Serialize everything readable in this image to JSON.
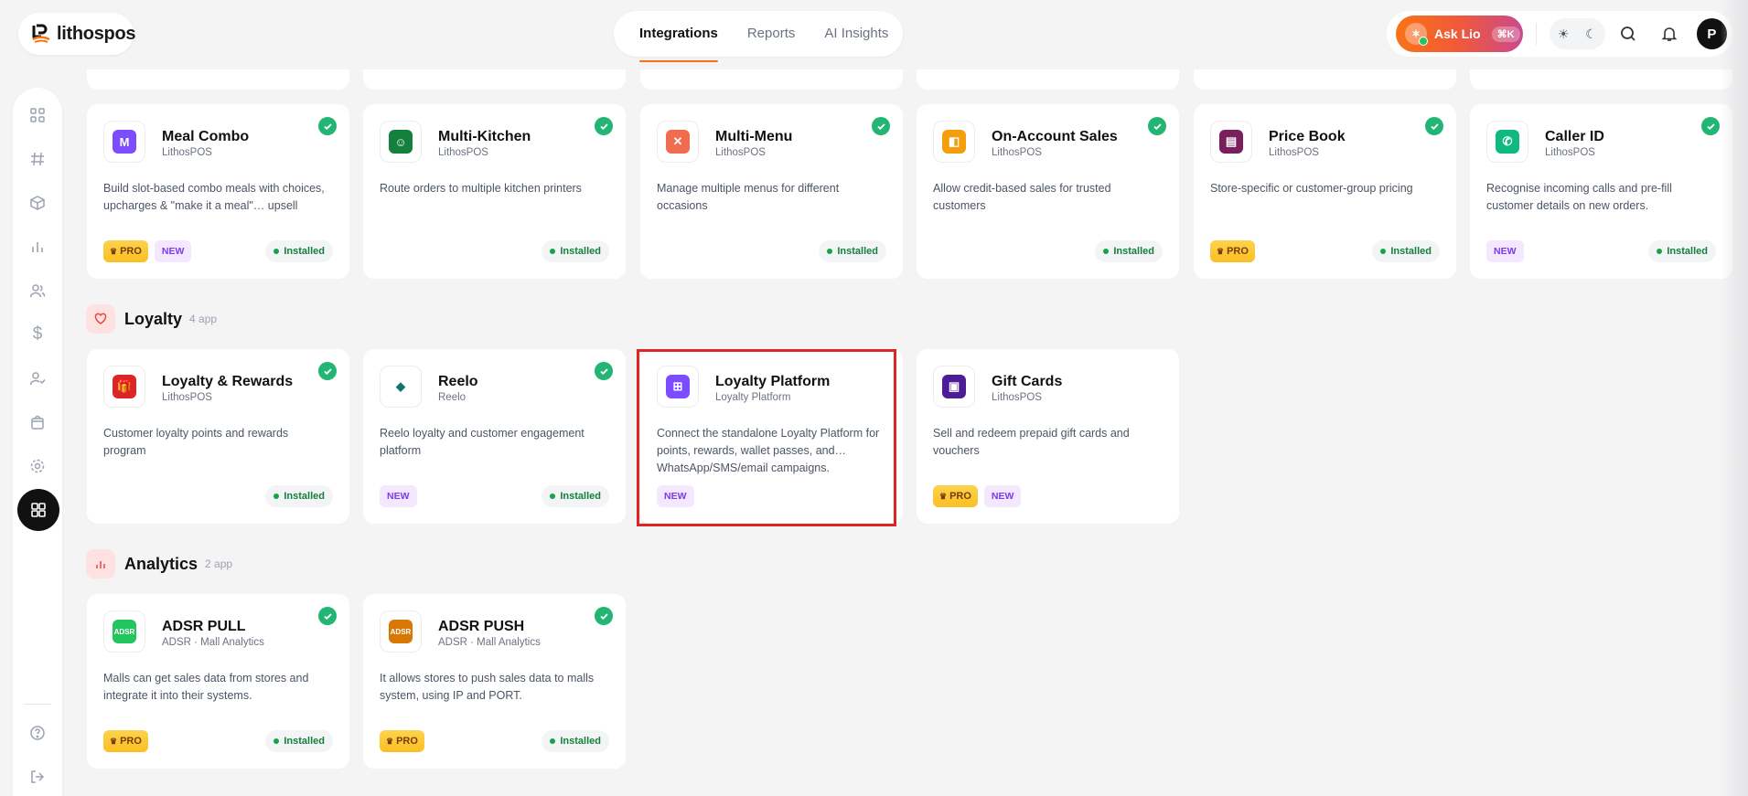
{
  "header": {
    "brand": "lithospos",
    "tabs": [
      {
        "label": "Integrations",
        "active": true
      },
      {
        "label": "Reports",
        "active": false
      },
      {
        "label": "AI Insights",
        "active": false
      }
    ],
    "ask_lio": {
      "label": "Ask Lio",
      "shortcut": "⌘K"
    },
    "avatar_initial": "P"
  },
  "sidebar": {
    "items": [
      "grid-icon",
      "hash-icon",
      "box-icon",
      "bar-chart-icon",
      "users-icon",
      "dollar-icon",
      "user-check-icon",
      "bag-icon",
      "settings-icon",
      "apps-icon"
    ],
    "active": "apps-icon",
    "footer": [
      "help-icon",
      "logout-icon"
    ]
  },
  "badges": {
    "pro": "PRO",
    "new": "NEW",
    "installed": "Installed"
  },
  "sections": {
    "top_row": [
      {
        "title": "Meal Combo",
        "vendor": "LithosPOS",
        "desc": "Build slot-based combo meals with choices, upcharges & \"make it a meal\"… upsell",
        "pro": true,
        "new": true,
        "installed": true,
        "icon": "combo-icon",
        "color": "#7c4dff",
        "glyph": "M"
      },
      {
        "title": "Multi-Kitchen",
        "vendor": "LithosPOS",
        "desc": "Route orders to multiple kitchen printers",
        "pro": false,
        "new": false,
        "installed": true,
        "icon": "chef-icon",
        "color": "#15803d",
        "glyph": "☺"
      },
      {
        "title": "Multi-Menu",
        "vendor": "LithosPOS",
        "desc": "Manage multiple menus for different occasions",
        "pro": false,
        "new": false,
        "installed": true,
        "icon": "menu-icon",
        "color": "#f26b4f",
        "glyph": "✕"
      },
      {
        "title": "On-Account Sales",
        "vendor": "LithosPOS",
        "desc": "Allow credit-based sales for trusted customers",
        "pro": false,
        "new": false,
        "installed": true,
        "icon": "basket-icon",
        "color": "#f59e0b",
        "glyph": "◧"
      },
      {
        "title": "Price Book",
        "vendor": "LithosPOS",
        "desc": "Store-specific or customer-group pricing",
        "pro": true,
        "new": false,
        "installed": true,
        "icon": "book-icon",
        "color": "#7a1f5c",
        "glyph": "▤"
      },
      {
        "title": "Caller ID",
        "vendor": "LithosPOS",
        "desc": "Recognise incoming calls and pre-fill customer details on new orders.",
        "pro": false,
        "new": true,
        "installed": true,
        "icon": "phone-icon",
        "color": "#10b981",
        "glyph": "✆"
      }
    ],
    "loyalty": {
      "title": "Loyalty",
      "count": "4 app",
      "apps": [
        {
          "title": "Loyalty & Rewards",
          "vendor": "LithosPOS",
          "desc": "Customer loyalty points and rewards program",
          "pro": false,
          "new": false,
          "installed": true,
          "icon": "gift-icon",
          "color": "#dc2626",
          "glyph": "🎁"
        },
        {
          "title": "Reelo",
          "vendor": "Reelo",
          "desc": "Reelo loyalty and customer engagement platform",
          "pro": false,
          "new": true,
          "installed": true,
          "icon": "reelo-icon",
          "color": "#ffffff",
          "glyph": "◆"
        },
        {
          "title": "Loyalty Platform",
          "vendor": "Loyalty Platform",
          "desc": "Connect the standalone Loyalty Platform for points, rewards, wallet passes, and… WhatsApp/SMS/email campaigns.",
          "pro": false,
          "new": true,
          "installed": false,
          "icon": "gift-box-icon",
          "color": "#7c4dff",
          "glyph": "⊞"
        },
        {
          "title": "Gift Cards",
          "vendor": "LithosPOS",
          "desc": "Sell and redeem prepaid gift cards and vouchers",
          "pro": true,
          "new": true,
          "installed": false,
          "icon": "giftcard-icon",
          "color": "#4c1d95",
          "glyph": "▣"
        }
      ]
    },
    "analytics": {
      "title": "Analytics",
      "count": "2 app",
      "apps": [
        {
          "title": "ADSR PULL",
          "vendor": "ADSR · Mall Analytics",
          "desc": "Malls can get sales data from stores and integrate it into their systems.",
          "pro": true,
          "new": false,
          "installed": true,
          "icon": "adsr-pull-icon",
          "color": "#22c55e",
          "glyph": "ADSR"
        },
        {
          "title": "ADSR PUSH",
          "vendor": "ADSR · Mall Analytics",
          "desc": "It allows stores to push sales data to malls system, using IP and PORT.",
          "pro": true,
          "new": false,
          "installed": true,
          "icon": "adsr-push-icon",
          "color": "#d97706",
          "glyph": "ADSR"
        }
      ]
    }
  }
}
